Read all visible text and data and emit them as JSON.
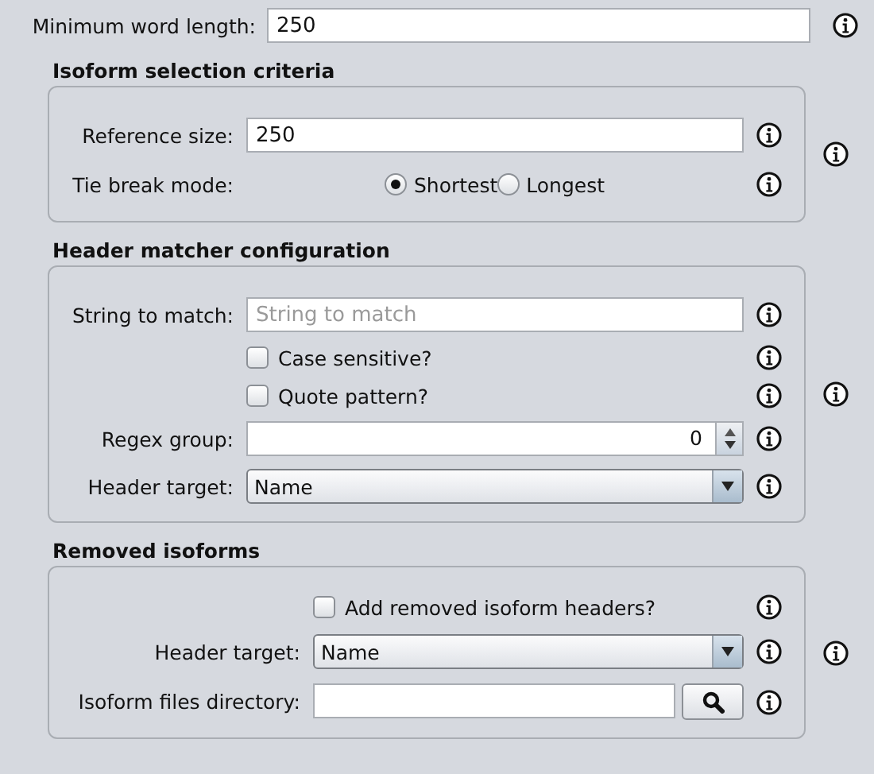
{
  "top_field": {
    "label": "Minimum word length:",
    "value": "250"
  },
  "sections": [
    {
      "title": "Isoform selection criteria",
      "rows": [
        {
          "kind": "text",
          "label": "Reference size:",
          "value": "250"
        },
        {
          "kind": "radio",
          "label": "Tie break mode:",
          "options": [
            {
              "label": "Shortest",
              "selected": true
            },
            {
              "label": "Longest",
              "selected": false
            }
          ]
        }
      ]
    },
    {
      "title": "Header matcher configuration",
      "rows": [
        {
          "kind": "text",
          "label": "String to match:",
          "placeholder": "String to match"
        },
        {
          "kind": "checkbox",
          "label": "Case sensitive?",
          "checked": false
        },
        {
          "kind": "checkbox",
          "label": "Quote pattern?",
          "checked": false
        },
        {
          "kind": "spinner",
          "label": "Regex group:",
          "value": "0"
        },
        {
          "kind": "dropdown",
          "label": "Header target:",
          "value": "Name"
        }
      ]
    },
    {
      "title": "Removed isoforms",
      "rows": [
        {
          "kind": "checkbox",
          "label": "Add removed isoform headers?",
          "checked": false
        },
        {
          "kind": "dropdown",
          "label": "Header target:",
          "value": "Name"
        },
        {
          "kind": "file",
          "label": "Isoform files directory:",
          "value": ""
        }
      ]
    }
  ]
}
